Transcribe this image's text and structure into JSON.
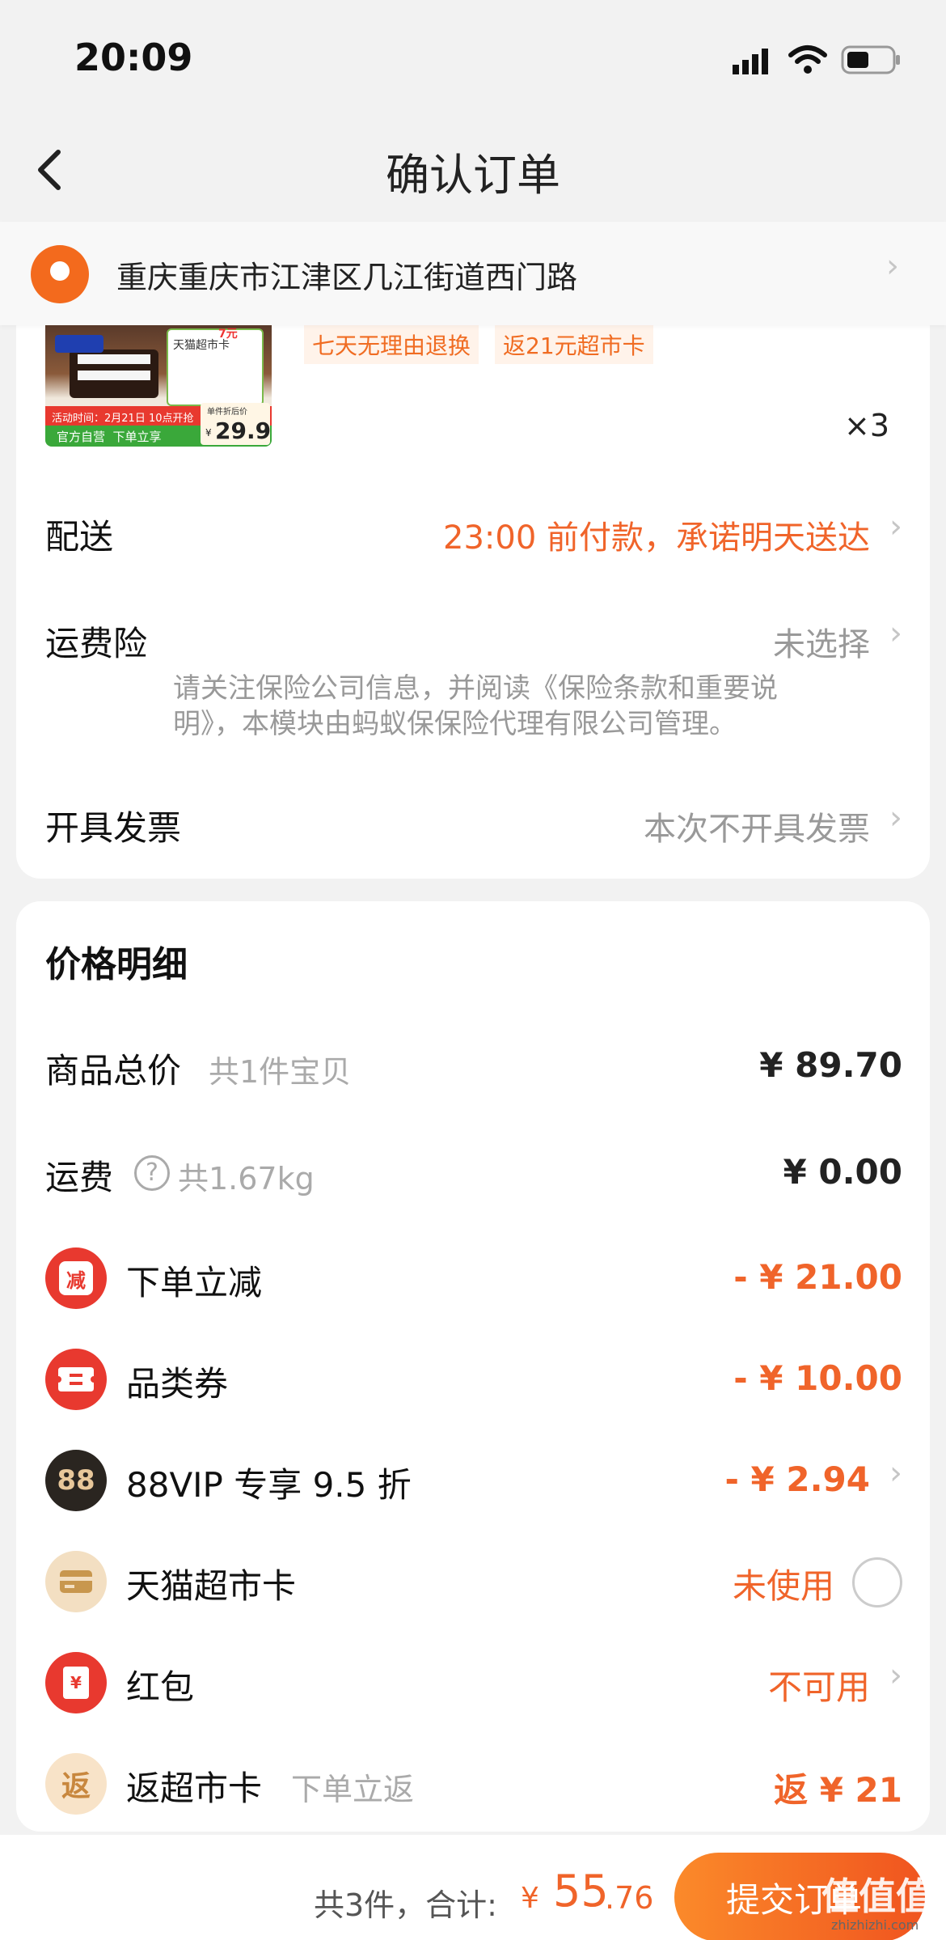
{
  "status_bar": {
    "time": "20:09"
  },
  "nav": {
    "title": "确认订单"
  },
  "address": {
    "text": "重庆重庆市江津区几江街道西门路"
  },
  "product": {
    "tags": [
      "七天无理由退换",
      "返21元超市卡"
    ],
    "quantity": "×3",
    "image_texts": {
      "event": "活动时间：2月21日 10点开抢",
      "badge": "官方自营  下单立享",
      "price_label": "单件折后价",
      "price": "29.9",
      "currency": "¥",
      "card_text": "天猫超市卡",
      "corner_num": "7元"
    }
  },
  "delivery": {
    "label": "配送",
    "value": "23:00 前付款，承诺明天送达"
  },
  "insurance": {
    "label": "运费险",
    "value": "未选择",
    "note_line1": "请关注保险公司信息，并阅读《保险条款和重要说",
    "note_line2": "明》，本模块由蚂蚁保保险代理有限公司管理。"
  },
  "invoice": {
    "label": "开具发票",
    "value": "本次不开具发票"
  },
  "price_detail": {
    "title": "价格明细",
    "goods_total": {
      "label": "商品总价",
      "sub": "共1件宝贝",
      "value": "¥ 89.70"
    },
    "shipping": {
      "label": "运费",
      "sub": "共1.67kg",
      "value": "¥ 0.00",
      "help": "?"
    },
    "items": [
      {
        "icon_text": "减",
        "label": "下单立减",
        "value": "- ¥ 21.00"
      },
      {
        "icon_text": "",
        "label": "品类券",
        "value": "- ¥ 10.00"
      },
      {
        "icon_text": "88",
        "label": "88VIP 专享 9.5 折",
        "value": "- ¥ 2.94"
      },
      {
        "icon_text": "",
        "label": "天猫超市卡",
        "value": "未使用"
      },
      {
        "icon_text": "¥",
        "label": "红包",
        "value": "不可用"
      },
      {
        "icon_text": "返",
        "label": "返超市卡",
        "sub": "下单立返",
        "value": "返 ¥ 21"
      }
    ]
  },
  "footer": {
    "count_text": "共3件，合计:",
    "currency": "¥",
    "total_int": "55",
    "total_dec": ".76",
    "submit_label": "提交订单"
  },
  "watermark": {
    "text": "值值值",
    "sub": "zhizhizhi.com"
  },
  "colors": {
    "accent": "#f0642a",
    "pin": "#f36a1d",
    "red_icon": "#e8392f",
    "dark_icon": "#2a2520",
    "gold_icon": "#f3dfc2"
  }
}
